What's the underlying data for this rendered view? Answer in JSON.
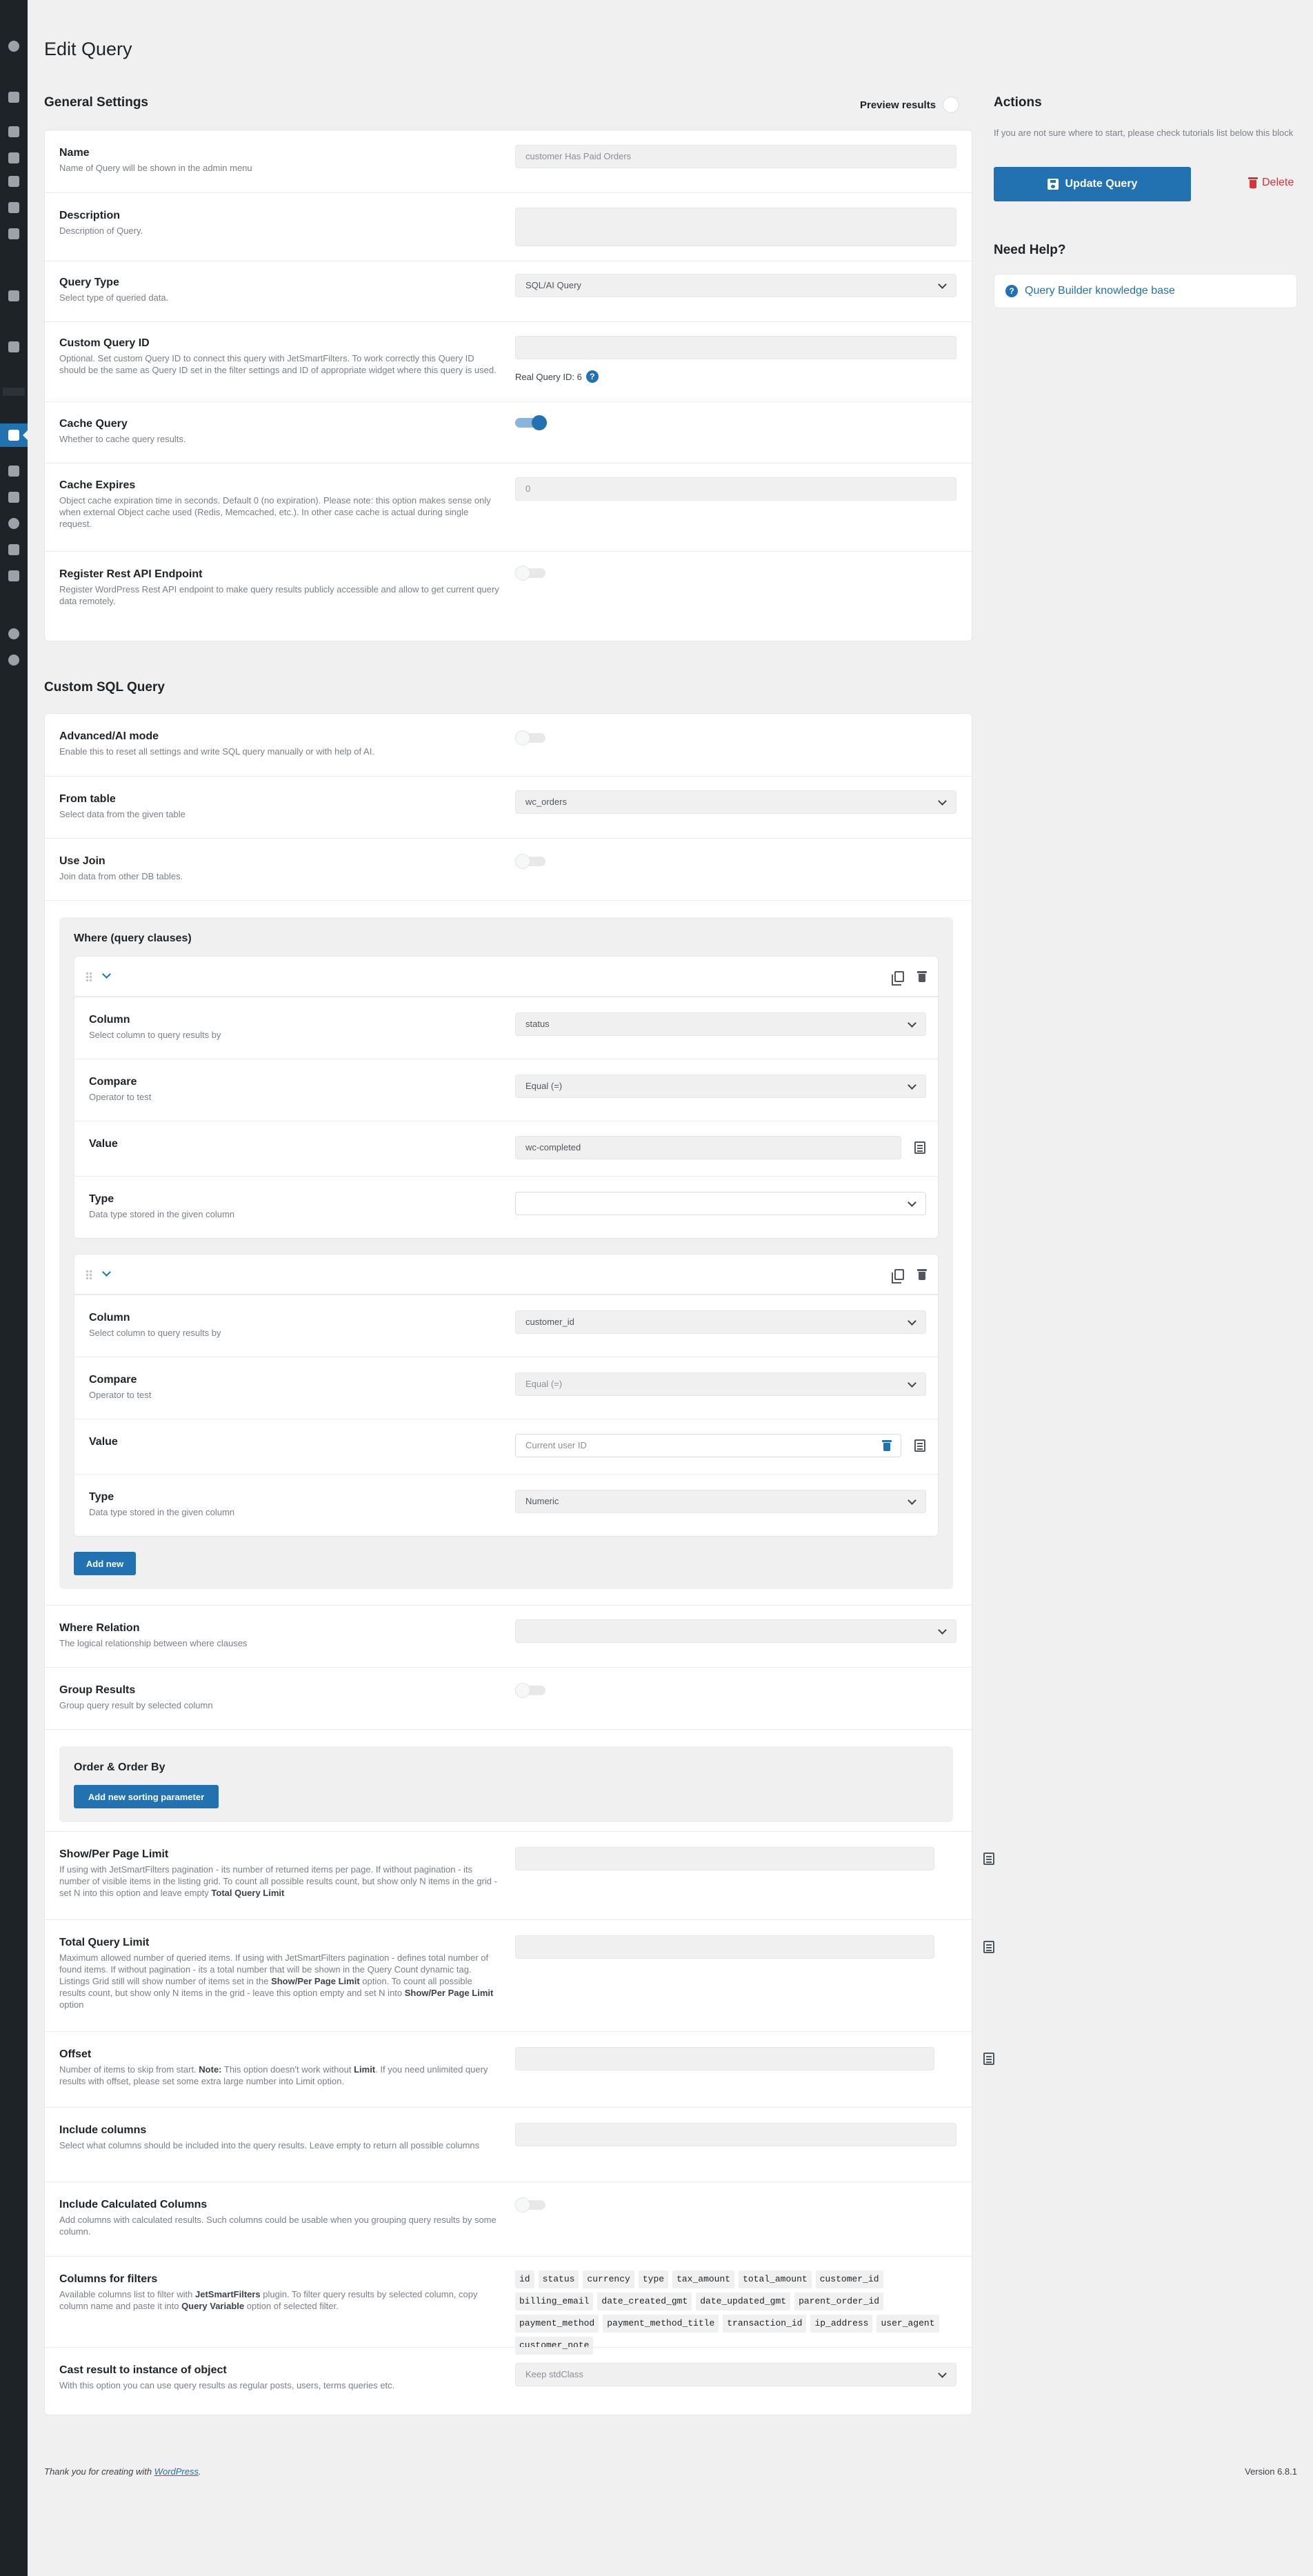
{
  "page": {
    "title": "Edit Query"
  },
  "admin_menu": {
    "icons": [
      "dashboard-icon",
      "jet-plugins-icon",
      "posts-icon",
      "plugins-icon",
      "media-icon",
      "pages-icon",
      "comments-icon",
      "templates-icon",
      "database-icon",
      "analytics-icon",
      "jetengine-icon",
      "appearance-icon",
      "plugins-tools-icon",
      "users-icon",
      "tools-icon",
      "settings-icon",
      "cloud-icon",
      "play-icon"
    ]
  },
  "general": {
    "title": "General Settings",
    "preview_label": "Preview results",
    "name": {
      "label": "Name",
      "desc": "Name of Query will be shown in the admin menu",
      "value": "customer Has Paid Orders"
    },
    "description": {
      "label": "Description",
      "desc": "Description of Query."
    },
    "query_type": {
      "label": "Query Type",
      "desc": "Select type of queried data.",
      "value": "SQL/AI Query"
    },
    "custom_id": {
      "label": "Custom Query ID",
      "desc": "Optional. Set custom Query ID to connect this query with JetSmartFilters. To work correctly this Query ID should be the same as Query ID set in the filter settings and ID of appropriate widget where this query is used.",
      "real_id_note": "Real Query ID: 6"
    },
    "cache_query": {
      "label": "Cache Query",
      "desc": "Whether to cache query results.",
      "enabled": true
    },
    "cache_expires": {
      "label": "Cache Expires",
      "desc": "Object cache expiration time in seconds. Default 0 (no expiration). Please note: this option makes sense only when external Object cache used (Redis, Memcached, etc.). In other case cache is actual during single request.",
      "value": "0"
    },
    "rest_api": {
      "label": "Register Rest API Endpoint",
      "desc": "Register WordPress Rest API endpoint to make query results publicly accessible and allow to get current query data remotely.",
      "enabled": false
    }
  },
  "sql": {
    "title": "Custom SQL Query",
    "advanced": {
      "label": "Advanced/AI mode",
      "desc": "Enable this to reset all settings and write SQL query manually or with help of AI.",
      "enabled": false
    },
    "from_table": {
      "label": "From table",
      "desc": "Select data from the given table",
      "value": "wc_orders"
    },
    "use_join": {
      "label": "Use Join",
      "desc": "Join data from other DB tables.",
      "enabled": false
    },
    "where": {
      "title": "Where (query clauses)",
      "clauses": [
        {
          "column": {
            "label": "Column",
            "desc": "Select column to query results by",
            "value": "status"
          },
          "compare": {
            "label": "Compare",
            "desc": "Operator to test",
            "value": "Equal (=)"
          },
          "value": {
            "label": "Value",
            "value": "wc-completed"
          },
          "type": {
            "label": "Type",
            "desc": "Data type stored in the given column",
            "value": ""
          }
        },
        {
          "column": {
            "label": "Column",
            "desc": "Select column to query results by",
            "value": "customer_id"
          },
          "compare": {
            "label": "Compare",
            "desc": "Operator to test",
            "value": "Equal (=)"
          },
          "value": {
            "label": "Value",
            "value": "Current user ID"
          },
          "type": {
            "label": "Type",
            "desc": "Data type stored in the given column",
            "value": "Numeric"
          }
        }
      ],
      "add_new": "Add new"
    },
    "where_relation": {
      "label": "Where Relation",
      "desc": "The logical relationship between where clauses",
      "value": ""
    },
    "group_results": {
      "label": "Group Results",
      "desc": "Group query result by selected column",
      "enabled": false
    },
    "order": {
      "title": "Order & Order By",
      "add_sort": "Add new sorting parameter"
    },
    "per_page": {
      "label": "Show/Per Page Limit",
      "desc_1": "If using with JetSmartFilters pagination - its number of returned items per page. If without pagination - its number of visible items in the listing grid. To count all possible results count, but show only N items in the grid - set N into this option and leave empty ",
      "desc_bold": "Total Query Limit"
    },
    "total_limit": {
      "label": "Total Query Limit",
      "desc_1": "Maximum allowed number of queried items. If using with JetSmartFilters pagination - defines total number of found items. If without pagination - its a total number that will be shown in the Query Count dynamic tag. Listings Grid still will show number of items set in the ",
      "desc_bold_1": "Show/Per Page Limit",
      "desc_2": " option. To count all possible results count, but show only N items in the grid - leave this option empty and set N into ",
      "desc_bold_2": "Show/Per Page Limit",
      "desc_3": " option"
    },
    "offset": {
      "label": "Offset",
      "desc_1": "Number of items to skip from start. ",
      "desc_bold_1": "Note:",
      "desc_2": " This option doesn't work without ",
      "desc_bold_2": "Limit",
      "desc_3": ". If you need unlimited query results with offset, please set some extra large number into Limit option."
    },
    "include_columns": {
      "label": "Include columns",
      "desc": "Select what columns should be included into the query results. Leave empty to return all possible columns"
    },
    "calc_columns": {
      "label": "Include Calculated Columns",
      "desc": "Add columns with calculated results. Such columns could be usable when you grouping query results by some column.",
      "enabled": false
    },
    "columns_for_filters": {
      "label": "Columns for filters",
      "desc_1": "Available columns list to filter with ",
      "desc_bold_1": "JetSmartFilters",
      "desc_2": " plugin. To filter query results by selected column, copy column name and paste it into ",
      "desc_bold_2": "Query Variable",
      "desc_3": " option of selected filter.",
      "tags": [
        "id",
        "status",
        "currency",
        "type",
        "tax_amount",
        "total_amount",
        "customer_id",
        "billing_email",
        "date_created_gmt",
        "date_updated_gmt",
        "parent_order_id",
        "payment_method",
        "payment_method_title",
        "transaction_id",
        "ip_address",
        "user_agent",
        "customer_note"
      ]
    },
    "cast_result": {
      "label": "Cast result to instance of object",
      "desc": "With this option you can use query results as regular posts, users, terms queries etc.",
      "value": "Keep stdClass"
    }
  },
  "actions": {
    "title": "Actions",
    "note": "If you are not sure where to start, please check tutorials list below this block",
    "update": "Update Query",
    "delete": "Delete"
  },
  "help": {
    "title": "Need Help?",
    "link": "Query Builder knowledge base"
  },
  "footer": {
    "thanks_prefix": "Thank you for creating with ",
    "wordpress": "WordPress",
    "thanks_suffix": ".",
    "version": "Version 6.8.1"
  },
  "colors": {
    "accent": "#2271b1",
    "danger": "#d63638",
    "menu_bg": "#1d2327",
    "page_bg": "#f0f0f1"
  }
}
